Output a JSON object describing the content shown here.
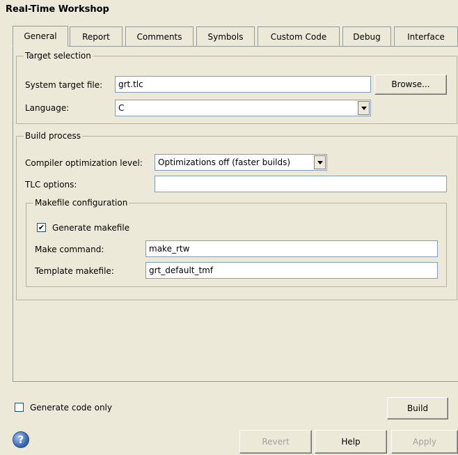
{
  "window": {
    "title": "Real-Time Workshop"
  },
  "tabs": [
    {
      "label": "General",
      "active": true
    },
    {
      "label": "Report"
    },
    {
      "label": "Comments"
    },
    {
      "label": "Symbols"
    },
    {
      "label": "Custom Code"
    },
    {
      "label": "Debug"
    },
    {
      "label": "Interface"
    }
  ],
  "target_selection": {
    "legend": "Target selection",
    "system_target_file_label": "System target file:",
    "system_target_file_value": "grt.tlc",
    "browse_label": "Browse...",
    "language_label": "Language:",
    "language_value": "C"
  },
  "build_process": {
    "legend": "Build process",
    "compiler_opt_label": "Compiler optimization level:",
    "compiler_opt_value": "Optimizations off (faster builds)",
    "tlc_options_label": "TLC options:",
    "tlc_options_value": "",
    "makefile": {
      "legend": "Makefile configuration",
      "generate_makefile_label": "Generate makefile",
      "generate_makefile_checked": true,
      "make_command_label": "Make command:",
      "make_command_value": "make_rtw",
      "template_makefile_label": "Template makefile:",
      "template_makefile_value": "grt_default_tmf"
    }
  },
  "footer": {
    "generate_code_only_label": "Generate code only",
    "generate_code_only_checked": false,
    "build_label": "Build",
    "revert_label": "Revert",
    "help_label": "Help",
    "apply_label": "Apply",
    "help_icon_glyph": "?"
  }
}
